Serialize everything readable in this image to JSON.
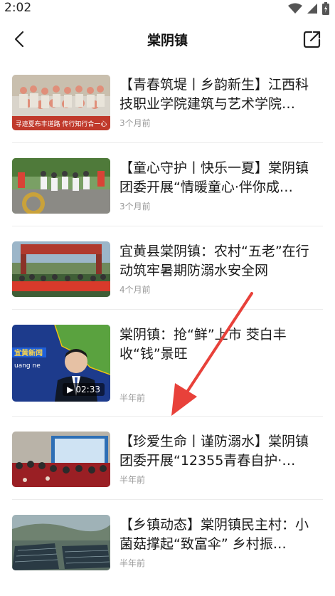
{
  "status_bar": {
    "time": "2:02"
  },
  "header": {
    "title": "棠阴镇"
  },
  "articles": [
    {
      "title": "【青春筑堤丨乡韵新生】江西科技职业学院建筑与艺术学院…",
      "time": "3个月前",
      "banner": "寻迹夏布丰道路 传行知行合一心"
    },
    {
      "title": "【童心守护丨快乐一夏】棠阴镇团委开展“情暖童心·伴你成…",
      "time": "3个月前"
    },
    {
      "title": "宜黄县棠阴镇：农村“五老”在行动筑牢暑期防溺水安全网",
      "time": "4个月前"
    },
    {
      "title": "棠阴镇：抢“鲜”上市 茭白丰收“钱”景旺",
      "time": "半年前",
      "duration": "02:33",
      "logo": "宜黄新闻",
      "logo_sub": "uang ne"
    },
    {
      "title": "【珍爱生命丨谨防溺水】棠阴镇团委开展“12355青春自护·…",
      "time": "半年前"
    },
    {
      "title": "【乡镇动态】棠阴镇民主村：小菌菇撑起“致富伞” 乡村振…",
      "time": "半年前"
    }
  ]
}
